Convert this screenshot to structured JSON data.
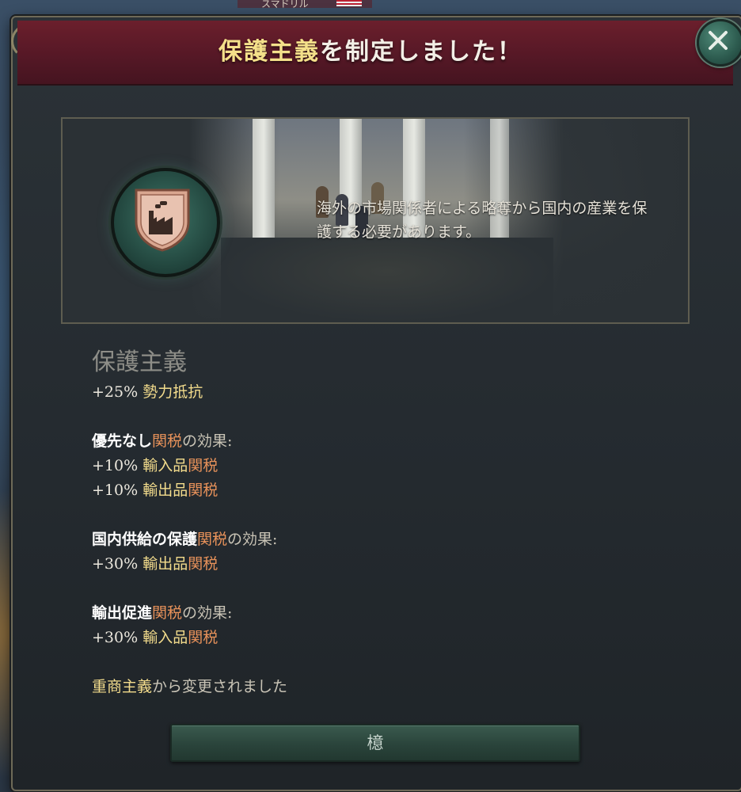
{
  "map": {
    "top_label": "スマドリル"
  },
  "dialog": {
    "title_highlight": "保護主義",
    "title_rest": "を制定しました！",
    "close_label": "✕",
    "description": "海外の市場関係者による略奪から国内の産業を保護する必要があります。",
    "law_name": "保護主義",
    "effects": [
      {
        "value": "+25%",
        "label": "勢力抵抗"
      }
    ],
    "sections": [
      {
        "heading": "優先なし",
        "tariff": "関税",
        "suffix": "の効果:",
        "lines": [
          {
            "value": "+10%",
            "label": "輸入品",
            "tariff": "関税"
          },
          {
            "value": "+10%",
            "label": "輸出品",
            "tariff": "関税"
          }
        ]
      },
      {
        "heading": "国内供給の保護",
        "tariff": "関税",
        "suffix": "の効果:",
        "lines": [
          {
            "value": "+30%",
            "label": "輸出品",
            "tariff": "関税"
          }
        ]
      },
      {
        "heading": "輸出促進",
        "tariff": "関税",
        "suffix": "の効果:",
        "lines": [
          {
            "value": "+30%",
            "label": "輸入品",
            "tariff": "関税"
          }
        ]
      }
    ],
    "changed_from_law": "重商主義",
    "changed_from_suffix": "から変更されました",
    "ok_button": "檍"
  },
  "colors": {
    "header": "#561826",
    "highlight_yellow": "#f3dc8c",
    "tariff_orange": "#e8925a",
    "button_green": "#2a443b"
  },
  "icons": {
    "close": "close-icon",
    "law": "factory-shield-icon"
  }
}
